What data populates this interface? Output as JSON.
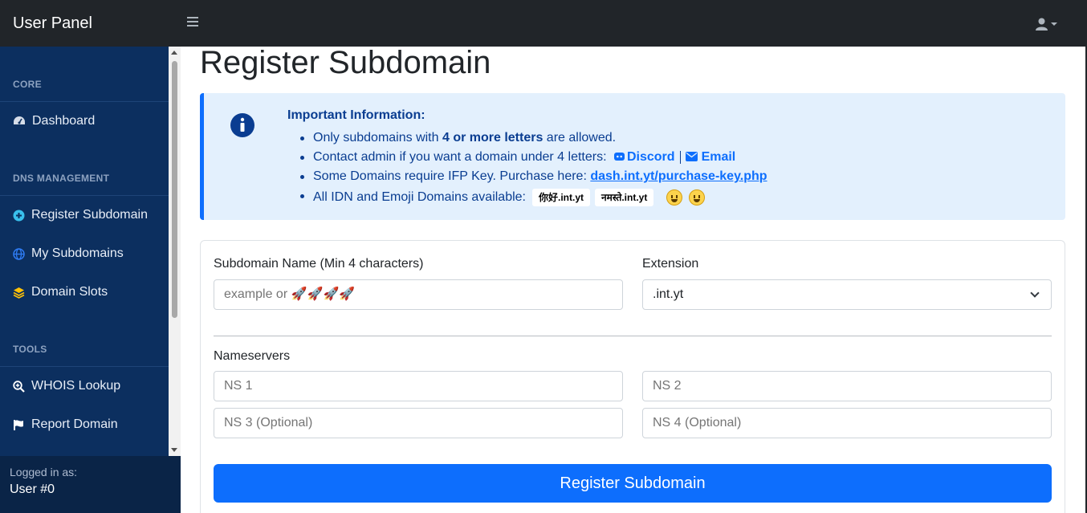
{
  "app": {
    "title": "User Panel"
  },
  "colors": {
    "primary": "#0d6efd",
    "sidebar": "#0c2f5f",
    "topbar": "#212529",
    "info_bg": "#e3f0fd"
  },
  "sidebar": {
    "sections": [
      {
        "heading": "CORE",
        "items": [
          {
            "label": "Dashboard",
            "icon": "tachometer-icon"
          }
        ]
      },
      {
        "heading": "DNS MANAGEMENT",
        "items": [
          {
            "label": "Register Subdomain",
            "icon": "plus-circle-icon"
          },
          {
            "label": "My Subdomains",
            "icon": "globe-icon"
          },
          {
            "label": "Domain Slots",
            "icon": "layers-icon"
          }
        ]
      },
      {
        "heading": "TOOLS",
        "items": [
          {
            "label": "WHOIS Lookup",
            "icon": "search-plus-icon"
          },
          {
            "label": "Report Domain",
            "icon": "flag-icon"
          }
        ]
      }
    ],
    "footer": {
      "label": "Logged in as:",
      "user": "User #0"
    }
  },
  "page": {
    "title": "Register Subdomain"
  },
  "info": {
    "title": "Important Information:",
    "rule1_pre": "Only subdomains with ",
    "rule1_bold": "4 or more letters",
    "rule1_post": " are allowed.",
    "rule2_pre": "Contact admin if you want a domain under 4 letters:",
    "discord": "Discord",
    "email": "Email",
    "rule3_pre": "Some Domains require IFP Key. Purchase here:",
    "purchase_link": "dash.int.yt/purchase-key.php",
    "rule4_pre": "All IDN and Emoji Domains available:",
    "idn_examples": [
      "你好.int.yt",
      "नमस्ते.int.yt"
    ]
  },
  "form": {
    "subdomain_label": "Subdomain Name (Min 4 characters)",
    "subdomain_placeholder": "example or 🚀🚀🚀🚀",
    "extension_label": "Extension",
    "extension_value": ".int.yt",
    "nameservers_heading": "Nameservers",
    "ns1_placeholder": "NS 1",
    "ns2_placeholder": "NS 2",
    "ns3_placeholder": "NS 3 (Optional)",
    "ns4_placeholder": "NS 4 (Optional)",
    "submit_label": "Register Subdomain"
  }
}
